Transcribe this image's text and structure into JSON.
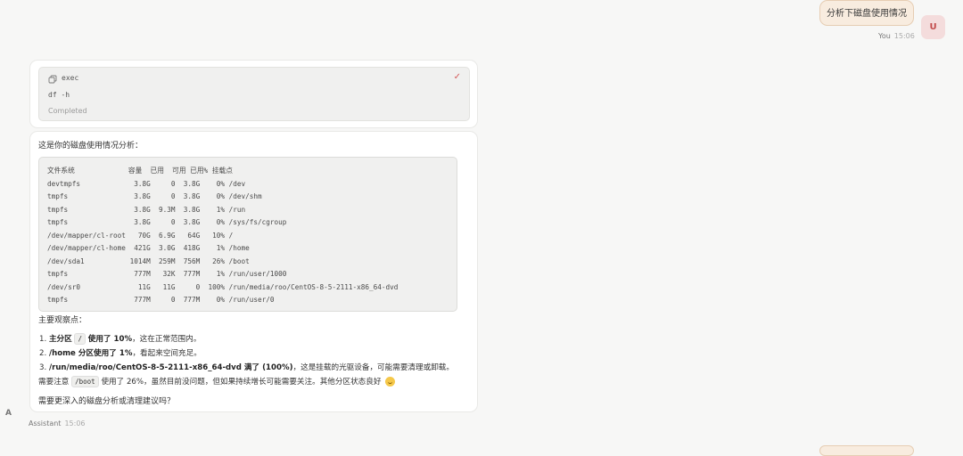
{
  "user_message": {
    "text": "分析下磁盘使用情况",
    "sender": "You",
    "time": "15:06",
    "avatar_initial": "U"
  },
  "tool_call": {
    "name": "exec",
    "command": "df -h",
    "status": "Completed"
  },
  "reply": {
    "intro": "这是你的磁盘使用情况分析：",
    "df_lines": [
      "文件系统             容量  已用  可用 已用% 挂载点",
      "devtmpfs             3.8G     0  3.8G    0% /dev",
      "tmpfs                3.8G     0  3.8G    0% /dev/shm",
      "tmpfs                3.8G  9.3M  3.8G    1% /run",
      "tmpfs                3.8G     0  3.8G    0% /sys/fs/cgroup",
      "/dev/mapper/cl-root   70G  6.9G   64G   10% /",
      "/dev/mapper/cl-home  421G  3.0G  418G    1% /home",
      "/dev/sda1           1014M  259M  756M   26% /boot",
      "tmpfs                777M   32K  777M    1% /run/user/1000",
      "/dev/sr0              11G   11G     0  100% /run/media/roo/CentOS-8-5-2111-x86_64-dvd",
      "tmpfs                777M     0  777M    0% /run/user/0"
    ],
    "observations_heading": "主要观察点：",
    "obs1": {
      "num": "1.",
      "bold_a": "主分区",
      "code": "/",
      "bold_b": "使用了 10%",
      "rest": "，这在正常范围内。"
    },
    "obs2": {
      "num": "2.",
      "bold": "/home 分区使用了 1%",
      "rest": "，看起来空间充足。"
    },
    "obs3": {
      "num": "3.",
      "bold": "/run/media/roo/CentOS-8-5-2111-x86_64-dvd 满了 (100%)",
      "rest": "，这是挂载的光驱设备，可能需要清理或卸载。",
      "prefix2": "需要注意",
      "code2": "/boot",
      "rest2": "使用了 26%，虽然目前没问题，但如果持续增长可能需要关注。其他分区状态良好"
    },
    "closing": "需要更深入的磁盘分析或清理建议吗？"
  },
  "assistant_meta": {
    "avatar_initial": "A",
    "sender": "Assistant",
    "time": "15:06"
  },
  "colors": {
    "user_bubble": "#f8ecdf",
    "avatar_bg": "#f4dcdc",
    "accent": "#d45a5a"
  }
}
